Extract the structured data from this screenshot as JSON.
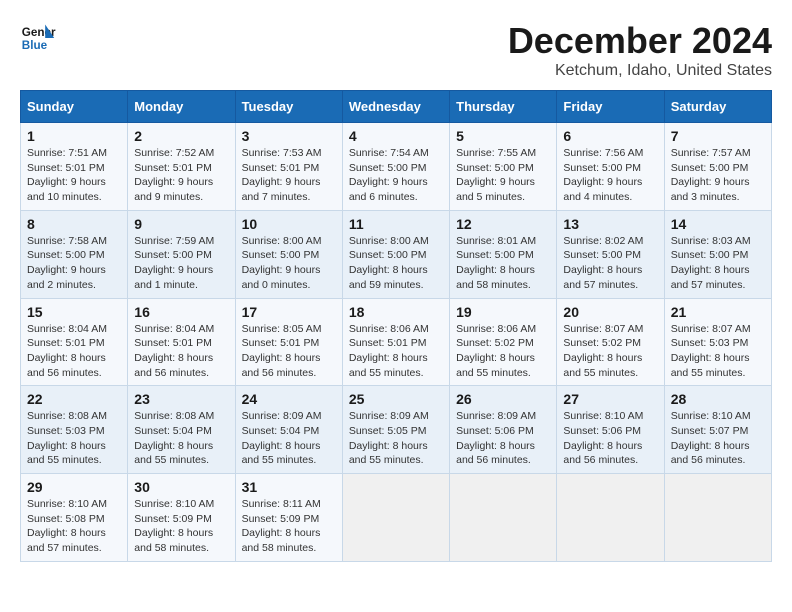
{
  "logo": {
    "line1": "General",
    "line2": "Blue"
  },
  "title": "December 2024",
  "location": "Ketchum, Idaho, United States",
  "days_header": [
    "Sunday",
    "Monday",
    "Tuesday",
    "Wednesday",
    "Thursday",
    "Friday",
    "Saturday"
  ],
  "weeks": [
    [
      {
        "day": "1",
        "info": "Sunrise: 7:51 AM\nSunset: 5:01 PM\nDaylight: 9 hours and 10 minutes."
      },
      {
        "day": "2",
        "info": "Sunrise: 7:52 AM\nSunset: 5:01 PM\nDaylight: 9 hours and 9 minutes."
      },
      {
        "day": "3",
        "info": "Sunrise: 7:53 AM\nSunset: 5:01 PM\nDaylight: 9 hours and 7 minutes."
      },
      {
        "day": "4",
        "info": "Sunrise: 7:54 AM\nSunset: 5:00 PM\nDaylight: 9 hours and 6 minutes."
      },
      {
        "day": "5",
        "info": "Sunrise: 7:55 AM\nSunset: 5:00 PM\nDaylight: 9 hours and 5 minutes."
      },
      {
        "day": "6",
        "info": "Sunrise: 7:56 AM\nSunset: 5:00 PM\nDaylight: 9 hours and 4 minutes."
      },
      {
        "day": "7",
        "info": "Sunrise: 7:57 AM\nSunset: 5:00 PM\nDaylight: 9 hours and 3 minutes."
      }
    ],
    [
      {
        "day": "8",
        "info": "Sunrise: 7:58 AM\nSunset: 5:00 PM\nDaylight: 9 hours and 2 minutes."
      },
      {
        "day": "9",
        "info": "Sunrise: 7:59 AM\nSunset: 5:00 PM\nDaylight: 9 hours and 1 minute."
      },
      {
        "day": "10",
        "info": "Sunrise: 8:00 AM\nSunset: 5:00 PM\nDaylight: 9 hours and 0 minutes."
      },
      {
        "day": "11",
        "info": "Sunrise: 8:00 AM\nSunset: 5:00 PM\nDaylight: 8 hours and 59 minutes."
      },
      {
        "day": "12",
        "info": "Sunrise: 8:01 AM\nSunset: 5:00 PM\nDaylight: 8 hours and 58 minutes."
      },
      {
        "day": "13",
        "info": "Sunrise: 8:02 AM\nSunset: 5:00 PM\nDaylight: 8 hours and 57 minutes."
      },
      {
        "day": "14",
        "info": "Sunrise: 8:03 AM\nSunset: 5:00 PM\nDaylight: 8 hours and 57 minutes."
      }
    ],
    [
      {
        "day": "15",
        "info": "Sunrise: 8:04 AM\nSunset: 5:01 PM\nDaylight: 8 hours and 56 minutes."
      },
      {
        "day": "16",
        "info": "Sunrise: 8:04 AM\nSunset: 5:01 PM\nDaylight: 8 hours and 56 minutes."
      },
      {
        "day": "17",
        "info": "Sunrise: 8:05 AM\nSunset: 5:01 PM\nDaylight: 8 hours and 56 minutes."
      },
      {
        "day": "18",
        "info": "Sunrise: 8:06 AM\nSunset: 5:01 PM\nDaylight: 8 hours and 55 minutes."
      },
      {
        "day": "19",
        "info": "Sunrise: 8:06 AM\nSunset: 5:02 PM\nDaylight: 8 hours and 55 minutes."
      },
      {
        "day": "20",
        "info": "Sunrise: 8:07 AM\nSunset: 5:02 PM\nDaylight: 8 hours and 55 minutes."
      },
      {
        "day": "21",
        "info": "Sunrise: 8:07 AM\nSunset: 5:03 PM\nDaylight: 8 hours and 55 minutes."
      }
    ],
    [
      {
        "day": "22",
        "info": "Sunrise: 8:08 AM\nSunset: 5:03 PM\nDaylight: 8 hours and 55 minutes."
      },
      {
        "day": "23",
        "info": "Sunrise: 8:08 AM\nSunset: 5:04 PM\nDaylight: 8 hours and 55 minutes."
      },
      {
        "day": "24",
        "info": "Sunrise: 8:09 AM\nSunset: 5:04 PM\nDaylight: 8 hours and 55 minutes."
      },
      {
        "day": "25",
        "info": "Sunrise: 8:09 AM\nSunset: 5:05 PM\nDaylight: 8 hours and 55 minutes."
      },
      {
        "day": "26",
        "info": "Sunrise: 8:09 AM\nSunset: 5:06 PM\nDaylight: 8 hours and 56 minutes."
      },
      {
        "day": "27",
        "info": "Sunrise: 8:10 AM\nSunset: 5:06 PM\nDaylight: 8 hours and 56 minutes."
      },
      {
        "day": "28",
        "info": "Sunrise: 8:10 AM\nSunset: 5:07 PM\nDaylight: 8 hours and 56 minutes."
      }
    ],
    [
      {
        "day": "29",
        "info": "Sunrise: 8:10 AM\nSunset: 5:08 PM\nDaylight: 8 hours and 57 minutes."
      },
      {
        "day": "30",
        "info": "Sunrise: 8:10 AM\nSunset: 5:09 PM\nDaylight: 8 hours and 58 minutes."
      },
      {
        "day": "31",
        "info": "Sunrise: 8:11 AM\nSunset: 5:09 PM\nDaylight: 8 hours and 58 minutes."
      },
      {
        "day": "",
        "info": ""
      },
      {
        "day": "",
        "info": ""
      },
      {
        "day": "",
        "info": ""
      },
      {
        "day": "",
        "info": ""
      }
    ]
  ]
}
